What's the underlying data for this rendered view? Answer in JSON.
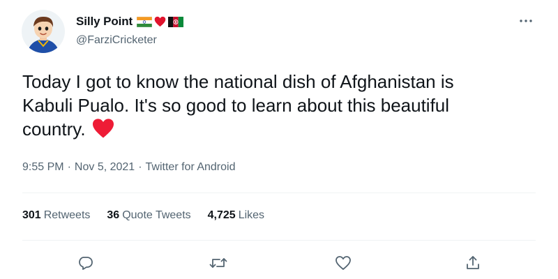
{
  "author": {
    "display_name": "Silly Point",
    "handle": "@FarziCricketer",
    "avatar_icon": "cartoon-cricketer-avatar",
    "flag_icons": [
      "india-flag-icon",
      "red-heart-icon",
      "afghanistan-flag-icon"
    ]
  },
  "tweet": {
    "text": "Today I got to know the national dish of Afghanistan is\nKabuli Pualo. It's so good to learn about this beautiful\ncountry.",
    "emoji_icon": "red-heart-icon"
  },
  "meta": {
    "time": "9:55 PM",
    "separator": "·",
    "date": "Nov 5, 2021",
    "source": "Twitter for Android"
  },
  "stats": [
    {
      "count": "301",
      "label": "Retweets"
    },
    {
      "count": "36",
      "label": "Quote Tweets"
    },
    {
      "count": "4,725",
      "label": "Likes"
    }
  ],
  "actions": [
    "reply-icon",
    "retweet-icon",
    "like-icon",
    "share-icon"
  ],
  "colors": {
    "text": "#0f1419",
    "secondary": "#536471",
    "divider": "#eff3f4",
    "heart": "#f91880"
  }
}
